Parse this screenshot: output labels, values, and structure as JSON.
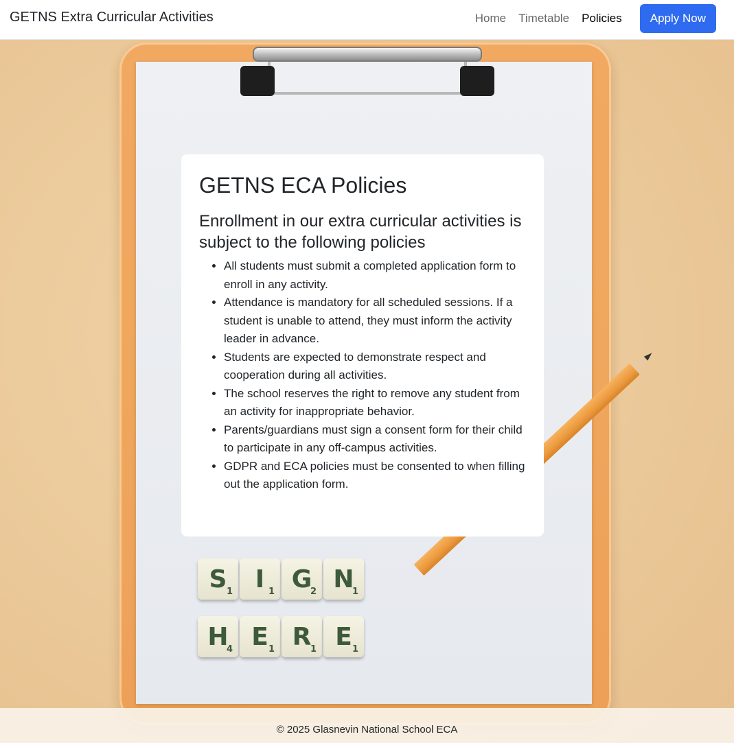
{
  "navbar": {
    "brand": "GETNS Extra Curricular Activities",
    "links": [
      {
        "label": "Home"
      },
      {
        "label": "Timetable"
      },
      {
        "label": "Policies"
      }
    ],
    "apply_label": "Apply Now"
  },
  "policies": {
    "title": "GETNS ECA Policies",
    "subtitle": "Enrollment in our extra curricular activities is subject to the following policies",
    "items": [
      "All students must submit a completed application form to enroll in any activity.",
      "Attendance is mandatory for all scheduled sessions. If a student is unable to attend, they must inform the activity leader in advance.",
      "Students are expected to demonstrate respect and cooperation during all activities.",
      "The school reserves the right to remove any student from an activity for inappropriate behavior.",
      "Parents/guardians must sign a consent form for their child to participate in any off-campus activities.",
      "GDPR and ECA policies must be consented to when filling out the application form."
    ]
  },
  "background": {
    "tiles_row1": [
      {
        "letter": "S",
        "points": "1"
      },
      {
        "letter": "I",
        "points": "1"
      },
      {
        "letter": "G",
        "points": "2"
      },
      {
        "letter": "N",
        "points": "1"
      }
    ],
    "tiles_row2": [
      {
        "letter": "H",
        "points": "4"
      },
      {
        "letter": "E",
        "points": "1"
      },
      {
        "letter": "R",
        "points": "1"
      },
      {
        "letter": "E",
        "points": "1"
      }
    ]
  },
  "footer": {
    "text": "© 2025 Glasnevin National School ECA"
  },
  "colors": {
    "primary": "#2f6bf0",
    "background": "#ecc99b",
    "clipboard": "#f0a55a"
  }
}
